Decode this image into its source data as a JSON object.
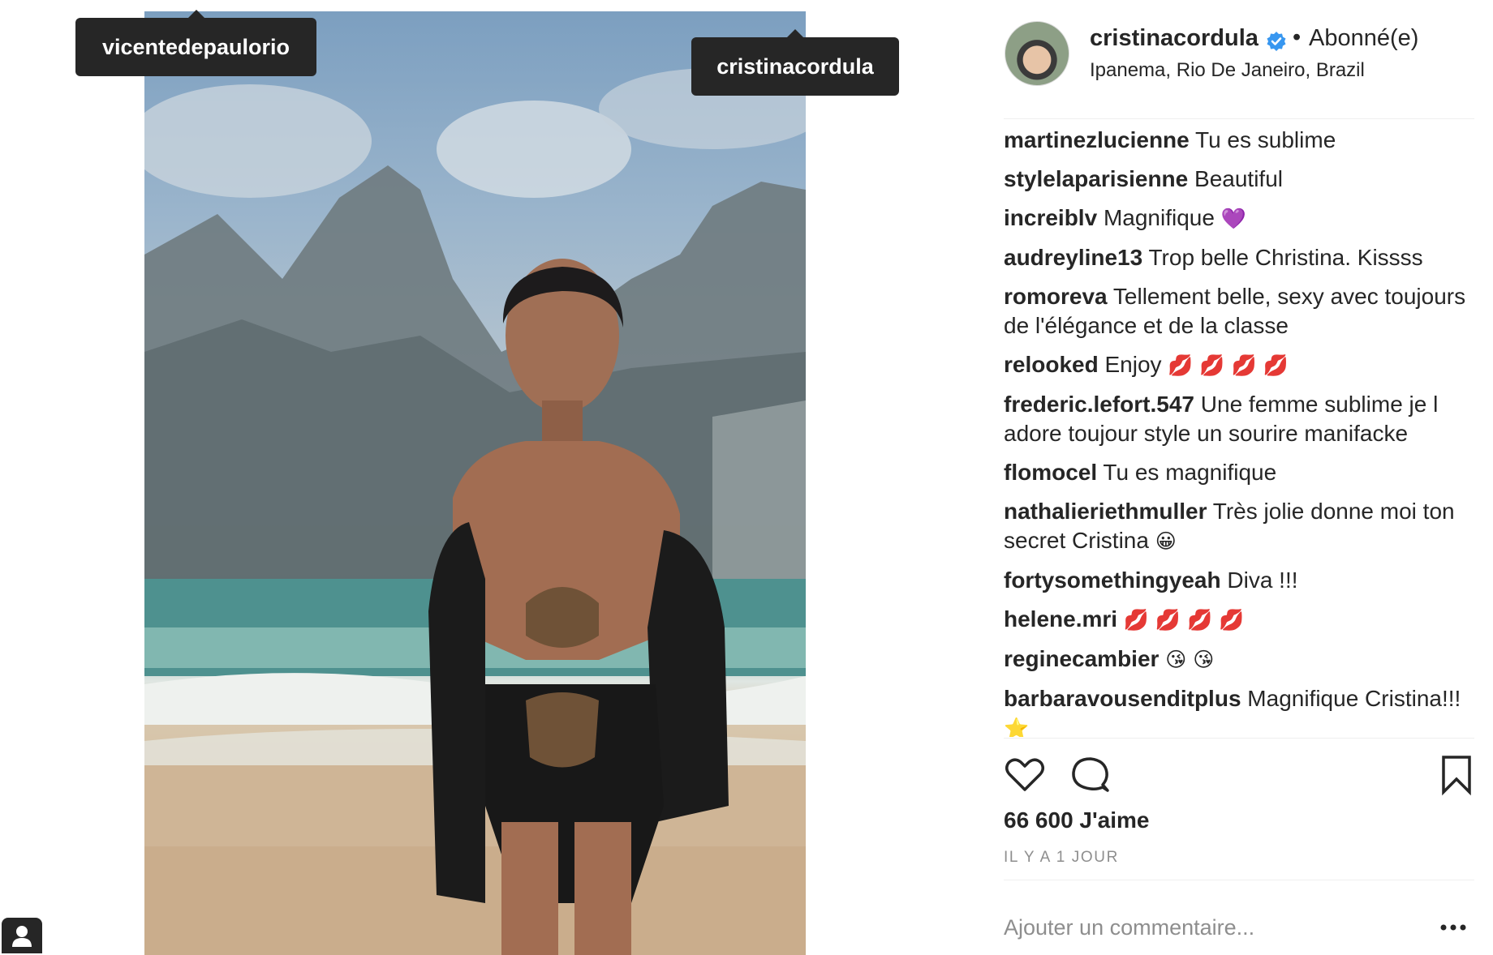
{
  "post": {
    "tags": [
      {
        "username": "vicentedepaulorio"
      },
      {
        "username": "cristinacordula"
      }
    ],
    "toggle_tags_icon": "user-silhouette-icon"
  },
  "header": {
    "username": "cristinacordula",
    "verified_icon": "verified-badge-icon",
    "separator": "•",
    "follow_status": "Abonné(e)",
    "location": "Ipanema, Rio De Janeiro, Brazil"
  },
  "comments": [
    {
      "user": "martinezlucienne",
      "text": "Tu es sublime",
      "emoji": ""
    },
    {
      "user": "stylelaparisienne",
      "text": "Beautiful",
      "emoji": ""
    },
    {
      "user": "increiblv",
      "text": "Magnifique",
      "emoji": "💜"
    },
    {
      "user": "audreyline13",
      "text": "Trop belle Christina. Kissss",
      "emoji": ""
    },
    {
      "user": "romoreva",
      "text": "Tellement belle, sexy avec toujours de l'élégance et de la classe",
      "emoji": ""
    },
    {
      "user": "relooked",
      "text": "Enjoy",
      "emoji": "💋 💋 💋 💋"
    },
    {
      "user": "frederic.lefort.547",
      "text": "Une femme sublime je l adore toujour style un sourire manifacke",
      "emoji": ""
    },
    {
      "user": "flomocel",
      "text": "Tu es magnifique",
      "emoji": ""
    },
    {
      "user": "nathalieriethmuller",
      "text": "Très jolie donne moi ton secret Cristina",
      "emoji": "😀"
    },
    {
      "user": "fortysomethingyeah",
      "text": "Diva !!!",
      "emoji": ""
    },
    {
      "user": "helene.mri",
      "text": "",
      "emoji": "💋 💋 💋 💋"
    },
    {
      "user": "reginecambier",
      "text": "",
      "emoji": "😘 😘"
    },
    {
      "user": "barbaravousenditplus",
      "text": "Magnifique Cristina!!!",
      "emoji": "⭐"
    }
  ],
  "actions": {
    "like_icon": "heart-icon",
    "comment_icon": "speech-bubble-icon",
    "save_icon": "bookmark-icon"
  },
  "likes": "66 600 J'aime",
  "timestamp": "IL Y A 1 JOUR",
  "add_comment": {
    "placeholder": "Ajouter un commentaire...",
    "more_icon": "ellipsis-icon"
  },
  "colors": {
    "text": "#262626",
    "muted": "#8e8e8e",
    "tag_bg": "#262626",
    "verified": "#3897f0",
    "divider": "#efefef"
  }
}
